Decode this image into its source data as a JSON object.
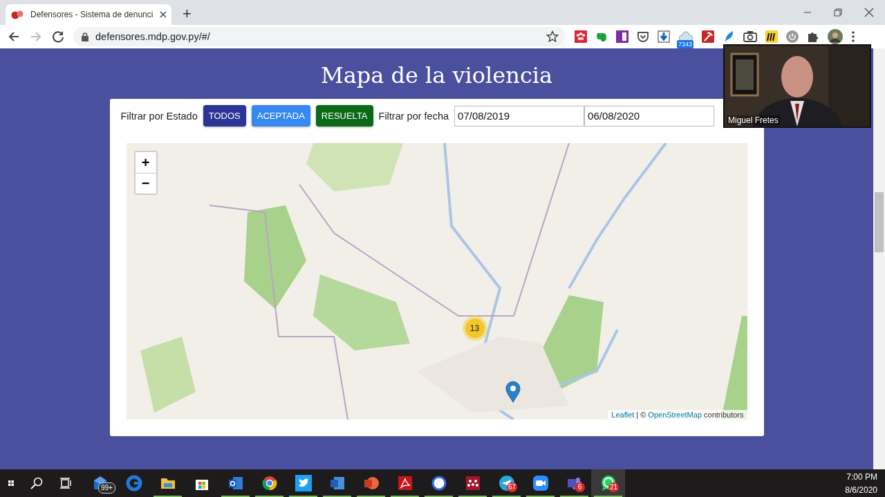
{
  "browser": {
    "tab_title": "Defensores - Sistema de denunci",
    "new_tab": "+",
    "address": "defensores.mdp.gov.py/#/",
    "forward_disabled": true,
    "extension_badge": "7343"
  },
  "page": {
    "heading": "Mapa de la violencia",
    "filter_state_label": "Filtrar por Estado",
    "state_buttons": [
      {
        "label": "TODOS",
        "color": "#2c3596"
      },
      {
        "label": "ACEPTADA",
        "color": "#3589f0"
      },
      {
        "label": "RESUELTA",
        "color": "#0b6a17"
      }
    ],
    "filter_date_label": "Filtrar por fecha",
    "date_from": "07/08/2019",
    "date_to": "06/08/2020",
    "map": {
      "zoom_in": "+",
      "zoom_out": "−",
      "cluster_count": "13",
      "attribution_link_1": "Leaflet",
      "attribution_text": "| ©",
      "attribution_link_2": "OpenStreetMap",
      "attribution_suffix": "contributors"
    }
  },
  "video": {
    "kind": "picture",
    "name": "Miguel Fretes"
  },
  "taskbar": {
    "apps": [
      {
        "kind": "mail",
        "running": false,
        "active": false,
        "badge": "99+"
      },
      {
        "kind": "edge",
        "running": false,
        "active": false
      },
      {
        "kind": "folder",
        "running": true,
        "active": false
      },
      {
        "kind": "store",
        "running": false,
        "active": false
      },
      {
        "kind": "outlook",
        "running": true,
        "active": false
      },
      {
        "kind": "chrome",
        "running": true,
        "active": false
      },
      {
        "kind": "twitter",
        "running": true,
        "active": false
      },
      {
        "kind": "word",
        "running": true,
        "active": false
      },
      {
        "kind": "powerpoint",
        "running": true,
        "active": false
      },
      {
        "kind": "acrobat",
        "running": true,
        "active": false
      },
      {
        "kind": "signal",
        "running": true,
        "active": false
      },
      {
        "kind": "mendeley",
        "running": true,
        "active": false
      },
      {
        "kind": "telegram",
        "running": true,
        "active": false,
        "badge": "67"
      },
      {
        "kind": "zoom",
        "running": true,
        "active": false
      },
      {
        "kind": "teams",
        "running": true,
        "active": false,
        "badge": "6"
      },
      {
        "kind": "whatsapp",
        "running": true,
        "active": true,
        "badge": "21"
      }
    ],
    "time": "7:00 PM",
    "date": "8/6/2020"
  }
}
